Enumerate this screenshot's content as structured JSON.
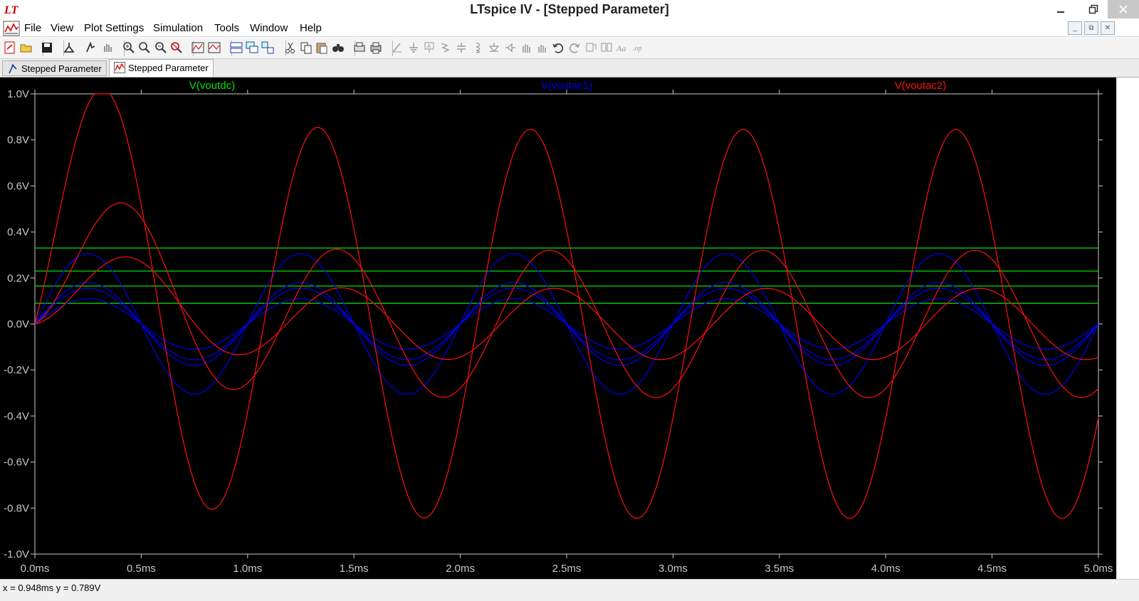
{
  "window": {
    "title": "LTspice IV - [Stepped Parameter]"
  },
  "menu": {
    "items": [
      "File",
      "View",
      "Plot Settings",
      "Simulation",
      "Tools",
      "Window",
      "Help"
    ]
  },
  "toolbar": {
    "icons": [
      "new-schematic-icon",
      "open-icon",
      "save-icon",
      "control-panel-icon",
      "run-icon",
      "pan-icon",
      "zoom-in-icon",
      "zoom-box-icon",
      "zoom-out-icon",
      "zoom-fit-icon",
      "autorange-icon",
      "pick-visible-traces-icon",
      "tile-horizontal-icon",
      "cascade-icon",
      "arrange-icon",
      "cut-icon",
      "copy-icon",
      "paste-icon",
      "find-icon",
      "print-preview-icon",
      "print-icon",
      "wire-icon",
      "ground-icon",
      "label-net-icon",
      "resistor-icon",
      "capacitor-icon",
      "inductor-icon",
      "diode-icon",
      "component-icon",
      "move-icon",
      "drag-icon",
      "undo-icon",
      "redo-icon",
      "rotate-icon",
      "mirror-icon",
      "text-icon",
      "spice-directive-icon"
    ]
  },
  "tabs": [
    {
      "label": "Stepped Parameter",
      "kind": "schematic",
      "active": false
    },
    {
      "label": "Stepped Parameter",
      "kind": "waveform",
      "active": true
    }
  ],
  "status": {
    "cursor_readout": "x = 0.948ms    y = 0.789V"
  },
  "colors": {
    "plot_background": "#000000",
    "axis_text": "#c8c8c8",
    "voutdc": "#00e000",
    "voutac1": "#0000f0",
    "voutac2": "#ff1010"
  },
  "chart_data": {
    "type": "line",
    "xlim": [
      0,
      5
    ],
    "ylim": [
      -1,
      1
    ],
    "grid": false,
    "legend_placement": "top",
    "x_ticks": [
      "0.0ms",
      "0.5ms",
      "1.0ms",
      "1.5ms",
      "2.0ms",
      "2.5ms",
      "3.0ms",
      "3.5ms",
      "4.0ms",
      "4.5ms",
      "5.0ms"
    ],
    "x_tick_values": [
      0,
      0.5,
      1,
      1.5,
      2,
      2.5,
      3,
      3.5,
      4,
      4.5,
      5
    ],
    "y_ticks": [
      "1.0V",
      "0.8V",
      "0.6V",
      "0.4V",
      "0.2V",
      "0.0V",
      "-0.2V",
      "-0.4V",
      "-0.6V",
      "-0.8V",
      "-1.0V"
    ],
    "y_tick_values": [
      1,
      0.8,
      0.6,
      0.4,
      0.2,
      0,
      -0.2,
      -0.4,
      -0.6,
      -0.8,
      -1
    ],
    "series": [
      {
        "name": "V(voutdc)",
        "color": "#00e000",
        "kind": "dc",
        "steps": [
          {
            "level": 0.33
          },
          {
            "level": 0.23
          },
          {
            "level": 0.165
          },
          {
            "level": 0.09
          }
        ]
      },
      {
        "name": "V(voutac1)",
        "color": "#0000f0",
        "kind": "sine",
        "period_ms": 1.0,
        "steps": [
          {
            "amplitude": 0.305
          },
          {
            "amplitude": 0.18
          },
          {
            "amplitude": 0.155
          },
          {
            "amplitude": 0.11
          }
        ]
      },
      {
        "name": "V(voutac2)",
        "color": "#ff1010",
        "kind": "filtered",
        "steps": [
          {
            "period_ms": 1.0,
            "peak": 0.86,
            "peak_at_ms": 0.33,
            "steady_amplitude": 0.845
          },
          {
            "period_ms": 1.0,
            "peak": 0.44,
            "peak_at_ms": 0.42,
            "steady_amplitude": 0.32
          },
          {
            "period_ms": 1.0,
            "peak": 0.25,
            "peak_at_ms": 0.44,
            "steady_amplitude": 0.155
          }
        ]
      }
    ]
  }
}
